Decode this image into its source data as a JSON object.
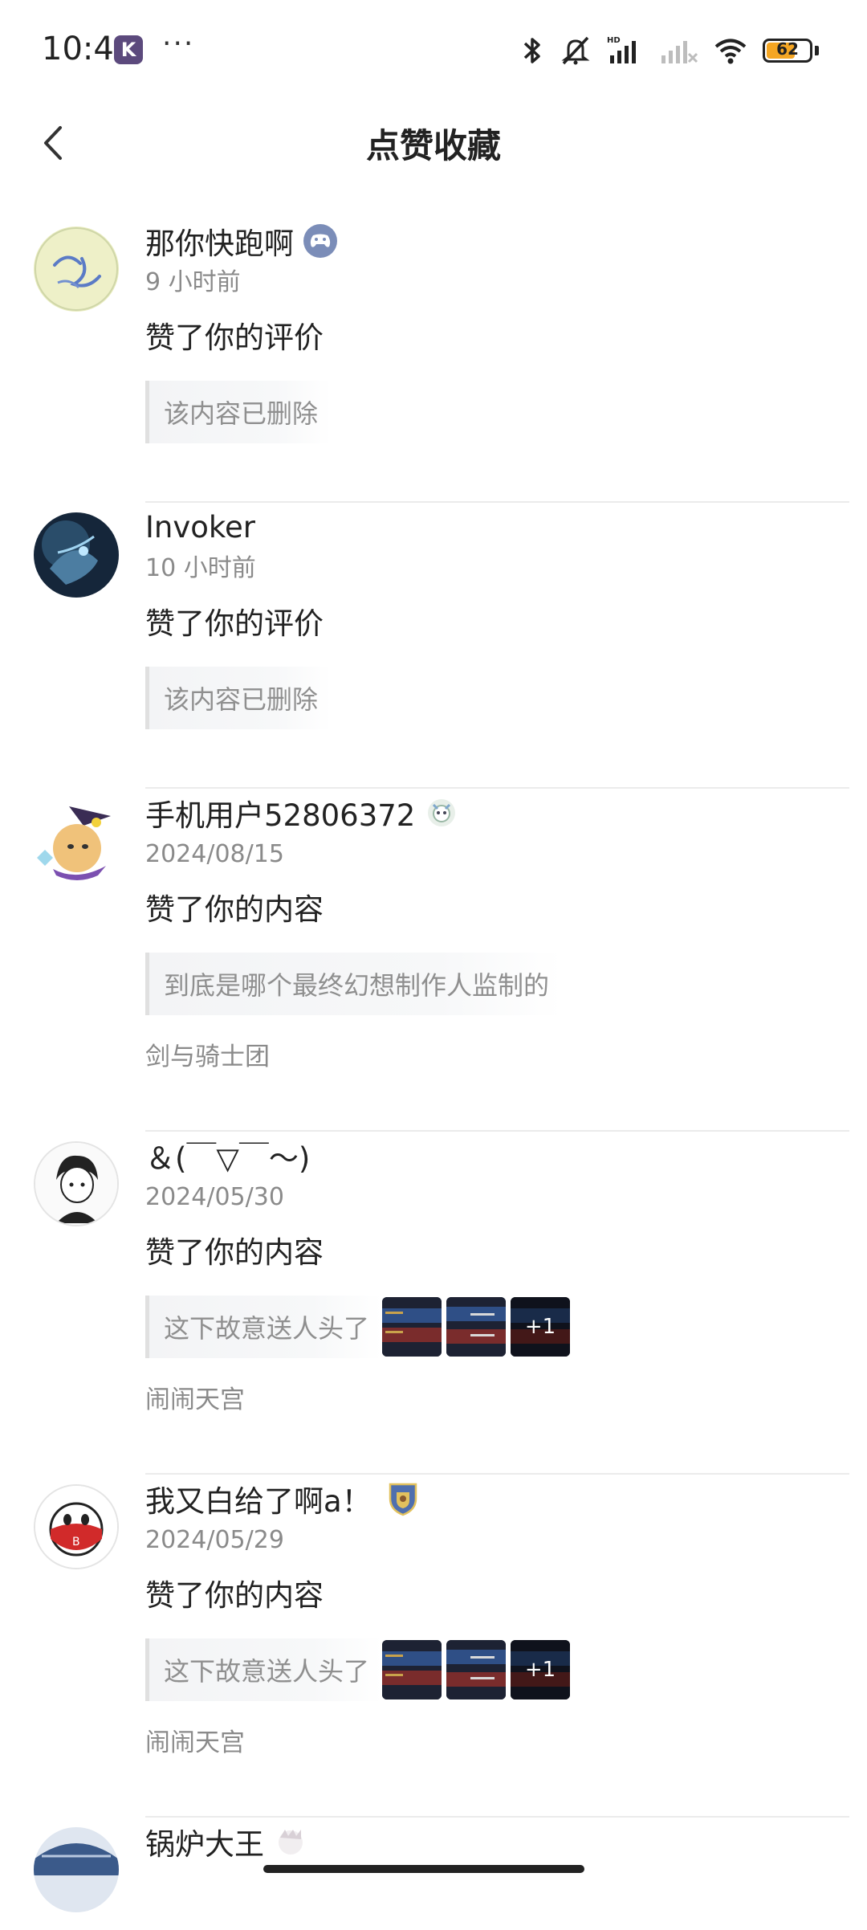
{
  "status_bar": {
    "time": "10:41",
    "app_badge": "K",
    "more": "···",
    "battery": "62",
    "icons": [
      "bluetooth-icon",
      "mute-icon",
      "hd-signal-icon",
      "no-signal-icon",
      "wifi-icon",
      "battery-icon"
    ]
  },
  "nav": {
    "title": "点赞收藏",
    "back_icon": "chevron-left-icon"
  },
  "colors": {
    "accent_badge": "#7b8db8",
    "muted_text": "#8a8a8a",
    "divider": "#ebebeb"
  },
  "items": [
    {
      "name": "那你快跑啊",
      "time": "9 小时前",
      "action": "赞了你的评价",
      "quote": "该内容已删除",
      "badge": "gamepad-icon"
    },
    {
      "name": "Invoker",
      "time": "10 小时前",
      "action": "赞了你的评价",
      "quote": "该内容已删除"
    },
    {
      "name": "手机用户52806372",
      "time": "2024/08/15",
      "action": "赞了你的内容",
      "quote": "到底是哪个最终幻想制作人监制的",
      "source": "剑与骑士团",
      "badge": "character-badge-icon"
    },
    {
      "name": "＆(￣▽￣～)",
      "time": "2024/05/30",
      "action": "赞了你的内容",
      "quote": "这下故意送人头了",
      "thumb_more": "+1",
      "source": "闹闹天宫"
    },
    {
      "name": "我又白给了啊a！",
      "time": "2024/05/29",
      "action": "赞了你的内容",
      "quote": "这下故意送人头了",
      "thumb_more": "+1",
      "source": "闹闹天宫",
      "badge": "shield-badge-icon"
    },
    {
      "name": "锅炉大王"
    }
  ]
}
